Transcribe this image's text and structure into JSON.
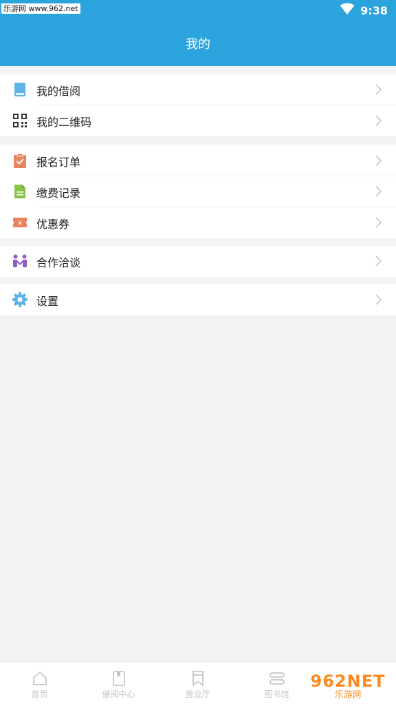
{
  "status_bar": {
    "watermark": "乐游网 www.962.net",
    "time": "9:38",
    "wifi_icon": "wifi-icon"
  },
  "header": {
    "title": "我的"
  },
  "groups": [
    {
      "items": [
        {
          "label": "我的借阅",
          "icon": "book-icon",
          "color": "#5fb3e6"
        },
        {
          "label": "我的二维码",
          "icon": "qrcode-icon",
          "color": "#333333"
        }
      ]
    },
    {
      "items": [
        {
          "label": "报名订单",
          "icon": "clipboard-check-icon",
          "color": "#e9825f"
        },
        {
          "label": "缴费记录",
          "icon": "document-icon",
          "color": "#8bc34a"
        },
        {
          "label": "优惠券",
          "icon": "coupon-icon",
          "color": "#e9825f"
        }
      ]
    },
    {
      "items": [
        {
          "label": "合作洽谈",
          "icon": "handshake-icon",
          "color": "#8e5cc9"
        }
      ]
    },
    {
      "items": [
        {
          "label": "设置",
          "icon": "gear-icon",
          "color": "#5fb3e6"
        }
      ]
    }
  ],
  "tabbar": {
    "tabs": [
      {
        "label": "首页",
        "icon": "home-icon"
      },
      {
        "label": "借阅中心",
        "icon": "bookmark-book-icon"
      },
      {
        "label": "营业厅",
        "icon": "bookmark-icon"
      },
      {
        "label": "图书馆",
        "icon": "library-icon"
      }
    ]
  },
  "watermark_br": {
    "brand": "962NET",
    "sub": "乐游网"
  }
}
